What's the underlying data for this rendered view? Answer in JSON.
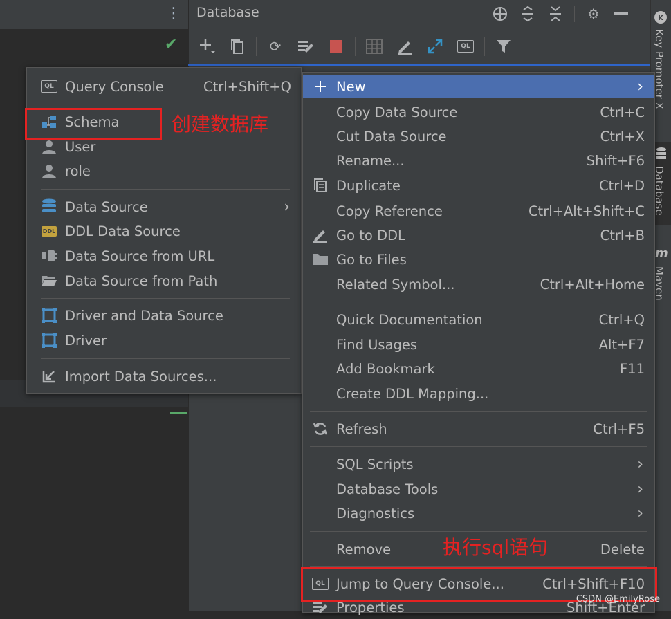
{
  "editor": {
    "check": "✔",
    "kebab": "⋮"
  },
  "db_panel": {
    "title": "Database"
  },
  "side_tabs": [
    "Key Promoter X",
    "Database",
    "Maven"
  ],
  "sub_menu": {
    "items": [
      {
        "label": "Query Console",
        "shortcut": "Ctrl+Shift+Q",
        "icon": "query-console-icon"
      },
      {
        "label": "Schema",
        "icon": "schema-icon"
      },
      {
        "label": "User",
        "icon": "user-icon"
      },
      {
        "label": "role",
        "icon": "role-icon"
      },
      {
        "label": "Data Source",
        "arrow": "›",
        "icon": "data-source-icon"
      },
      {
        "label": "DDL Data Source",
        "icon": "ddl-icon"
      },
      {
        "label": "Data Source from URL",
        "icon": "url-plug-icon"
      },
      {
        "label": "Data Source from Path",
        "icon": "folder-open-icon"
      },
      {
        "label": "Driver and Data Source",
        "icon": "driver-icon"
      },
      {
        "label": "Driver",
        "icon": "driver-icon"
      },
      {
        "label": "Import Data Sources...",
        "icon": "import-icon"
      }
    ]
  },
  "main_menu": {
    "items": [
      {
        "label": "New",
        "arrow": "›",
        "icon": "plus-icon"
      },
      {
        "label": "Copy Data Source",
        "shortcut": "Ctrl+C"
      },
      {
        "label": "Cut Data Source",
        "shortcut": "Ctrl+X"
      },
      {
        "label": "Rename...",
        "shortcut": "Shift+F6"
      },
      {
        "label": "Duplicate",
        "shortcut": "Ctrl+D",
        "icon": "duplicate-icon"
      },
      {
        "label": "Copy Reference",
        "shortcut": "Ctrl+Alt+Shift+C"
      },
      {
        "label": "Go to DDL",
        "shortcut": "Ctrl+B",
        "icon": "edit-pencil-icon"
      },
      {
        "label": "Go to Files",
        "icon": "folder-icon"
      },
      {
        "label": "Related Symbol...",
        "shortcut": "Ctrl+Alt+Home"
      },
      {
        "label": "Quick Documentation",
        "shortcut": "Ctrl+Q"
      },
      {
        "label": "Find Usages",
        "shortcut": "Alt+F7"
      },
      {
        "label": "Add Bookmark",
        "shortcut": "F11"
      },
      {
        "label": "Create DDL Mapping..."
      },
      {
        "label": "Refresh",
        "shortcut": "Ctrl+F5",
        "icon": "refresh-icon"
      },
      {
        "label": "SQL Scripts",
        "arrow": "›"
      },
      {
        "label": "Database Tools",
        "arrow": "›"
      },
      {
        "label": "Diagnostics",
        "arrow": "›"
      },
      {
        "label": "Remove",
        "shortcut": "Delete"
      },
      {
        "label": "Jump to Query Console...",
        "shortcut": "Ctrl+Shift+F10",
        "icon": "query-console-icon"
      },
      {
        "label": "Properties",
        "shortcut": "Shift+Enter",
        "icon": "properties-icon"
      }
    ]
  },
  "annotations": {
    "schema_note": "创建数据库",
    "query_note": "执行sql语句"
  },
  "watermark": "CSDN @EmilyRose",
  "colors": {
    "selection": "#4b6eaf",
    "menu_bg": "#3c3f41",
    "annotation_red": "#e52222"
  }
}
